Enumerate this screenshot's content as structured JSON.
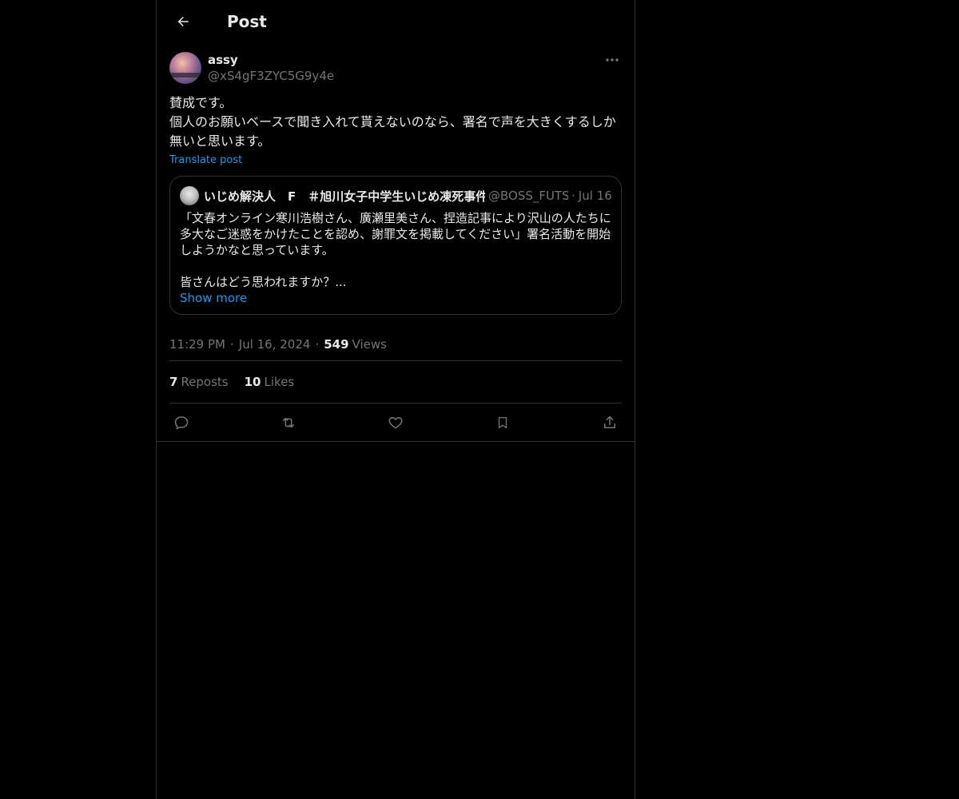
{
  "header": {
    "title": "Post"
  },
  "post": {
    "author": {
      "display_name": "assy",
      "handle": "@xS4gF3ZYC5G9y4e"
    },
    "text": "賛成です。\n個人のお願いベースで聞き入れて貰えないのなら、署名で声を大きくするしか無いと思います。",
    "translate_label": "Translate post",
    "quote": {
      "author_name": "いじめ解決人　F　＃旭川女子中学生いじめ凍死事件",
      "author_handle": "@BOSS_FUTSUI",
      "date": "Jul 16",
      "text": "「文春オンライン寒川浩樹さん、廣瀬里美さん、捏造記事により沢山の人たちに多大なご迷惑をかけたことを認め、謝罪文を掲載してください」署名活動を開始しようかなと思っています。\n\n皆さんはどう思われますか？...",
      "show_more": "Show more"
    },
    "time": "11:29 PM",
    "date": "Jul 16, 2024",
    "views_count": "549",
    "views_label": "Views",
    "reposts_count": "7",
    "reposts_label": "Reposts",
    "likes_count": "10",
    "likes_label": "Likes"
  },
  "icons": {
    "back": "arrow-left-icon",
    "more": "more-horizontal-icon",
    "reply": "reply-icon",
    "repost": "repost-icon",
    "like": "heart-icon",
    "bookmark": "bookmark-icon",
    "share": "share-icon"
  },
  "colors": {
    "background": "#000000",
    "text": "#e7e9ea",
    "secondary": "#71767b",
    "accent": "#1d9bf0",
    "border": "#2f3336"
  }
}
